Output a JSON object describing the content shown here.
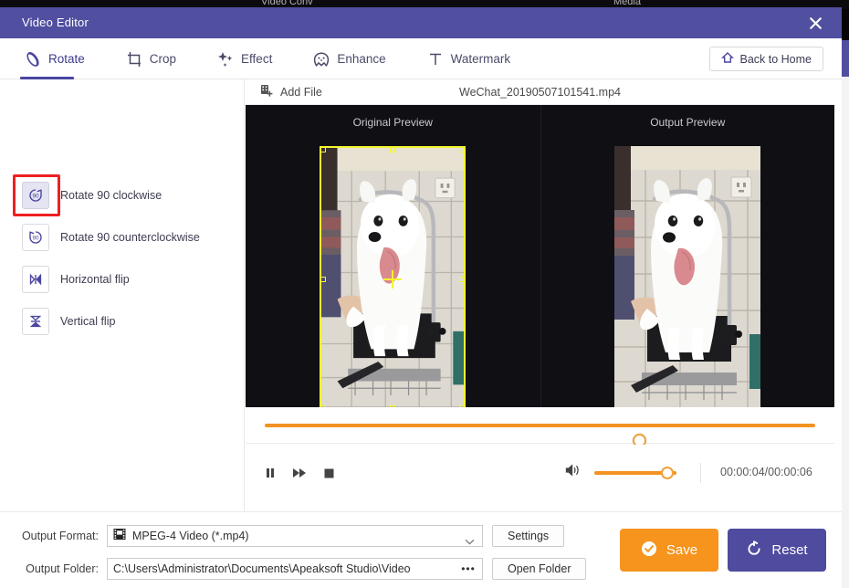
{
  "background": {
    "ghost_label_left": "Video Conv",
    "ghost_label_right": "Media"
  },
  "window": {
    "title": "Video Editor",
    "close_label": "✕"
  },
  "toolbar": {
    "tabs": [
      {
        "label": "Rotate",
        "icon": "rotate-icon",
        "active": true
      },
      {
        "label": "Crop",
        "icon": "crop-icon",
        "active": false
      },
      {
        "label": "Effect",
        "icon": "sparkle-icon",
        "active": false
      },
      {
        "label": "Enhance",
        "icon": "enhance-icon",
        "active": false
      },
      {
        "label": "Watermark",
        "icon": "text-t-icon",
        "active": false
      }
    ],
    "back_home_label": "Back to Home",
    "back_home_icon": "home-icon"
  },
  "sidebar": {
    "items": [
      {
        "label": "Rotate 90 clockwise",
        "icon": "rotate-cw-90-icon",
        "selected": true
      },
      {
        "label": "Rotate 90 counterclockwise",
        "icon": "rotate-ccw-90-icon",
        "selected": false
      },
      {
        "label": "Horizontal flip",
        "icon": "horizontal-flip-icon",
        "selected": false
      },
      {
        "label": "Vertical flip",
        "icon": "vertical-flip-icon",
        "selected": false
      }
    ],
    "highlight_color": "#ef1f20"
  },
  "filebar": {
    "add_file_label": "Add File",
    "add_file_icon": "add-file-icon",
    "file_name": "WeChat_20190507101541.mp4"
  },
  "preview": {
    "original_title": "Original Preview",
    "output_title": "Output Preview",
    "selection_color": "#f5f530"
  },
  "timeline": {
    "progress_percent": 68,
    "track_color": "#f29220"
  },
  "transport": {
    "buttons": [
      {
        "name": "pause-button",
        "icon": "pause-icon"
      },
      {
        "name": "fast-forward-button",
        "icon": "fast-forward-icon"
      },
      {
        "name": "stop-button",
        "icon": "stop-icon"
      }
    ],
    "volume_icon": "volume-icon",
    "volume_percent": 82,
    "time_display": "00:00:04/00:00:06"
  },
  "footer": {
    "output_format_label": "Output Format:",
    "output_format_value": "MPEG-4 Video (*.mp4)",
    "output_format_icon": "mpeg-file-icon",
    "settings_label": "Settings",
    "output_folder_label": "Output Folder:",
    "output_folder_value": "C:\\Users\\Administrator\\Documents\\Apeaksoft Studio\\Video",
    "browse_label": "•••",
    "open_folder_label": "Open Folder",
    "save_label": "Save",
    "save_icon": "check-circle-icon",
    "reset_label": "Reset",
    "reset_icon": "reset-icon",
    "save_color": "#f6941d",
    "reset_color": "#4f4b9e"
  }
}
